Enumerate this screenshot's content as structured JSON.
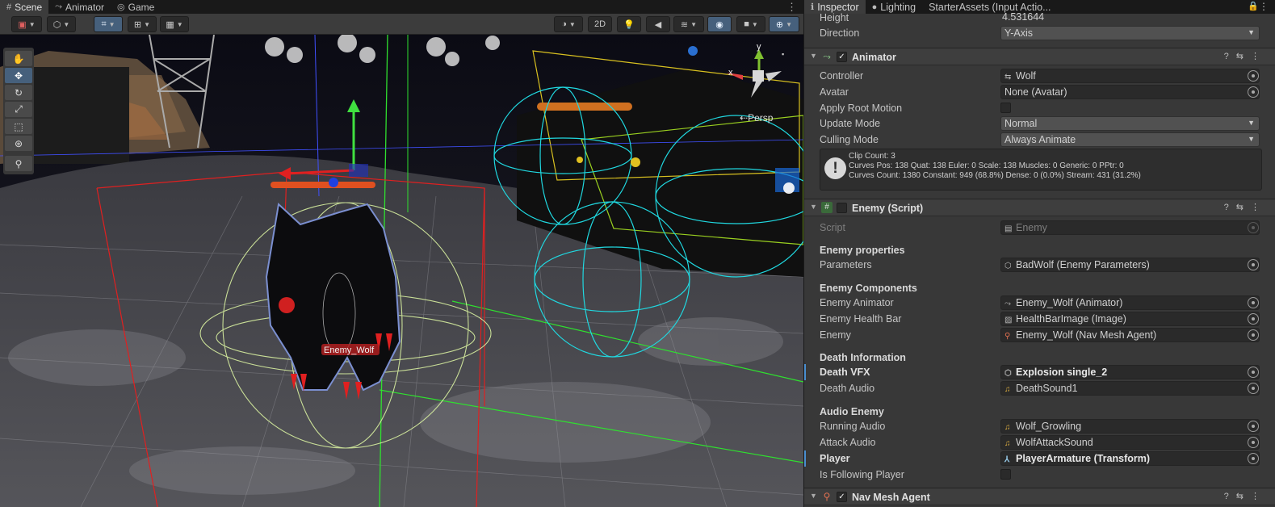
{
  "scene_tabs": [
    {
      "label": "Scene",
      "icon": "grid-icon"
    },
    {
      "label": "Animator",
      "icon": "animator-icon"
    },
    {
      "label": "Game",
      "icon": "gamepad-icon"
    }
  ],
  "scene_toolbar": {
    "twod_label": "2D"
  },
  "scene_view": {
    "persp_label": "Persp",
    "gizmo_axes": {
      "y": "y",
      "x": "x"
    },
    "enemy_label": "Enemy_Wolf"
  },
  "inspector_tabs": [
    {
      "label": "Inspector",
      "icon": "info-icon"
    },
    {
      "label": "Lighting",
      "icon": "bulb-icon"
    },
    {
      "label": "StarterAssets (Input Actio...",
      "icon": ""
    }
  ],
  "top_fields": [
    {
      "label": "Height",
      "value": "4.531644"
    },
    {
      "label": "Direction",
      "value": "Y-Axis"
    }
  ],
  "animator": {
    "title": "Animator",
    "enabled": true,
    "controller": {
      "label": "Controller",
      "value": "Wolf"
    },
    "avatar": {
      "label": "Avatar",
      "value": "None (Avatar)"
    },
    "apply_root_motion": {
      "label": "Apply Root Motion",
      "checked": false
    },
    "update_mode": {
      "label": "Update Mode",
      "value": "Normal"
    },
    "culling_mode": {
      "label": "Culling Mode",
      "value": "Always Animate"
    },
    "info": [
      "Clip Count: 3",
      "Curves Pos: 138 Quat: 138 Euler: 0 Scale: 138 Muscles: 0 Generic: 0 PPtr: 0",
      "Curves Count: 1380 Constant: 949 (68.8%) Dense: 0 (0.0%) Stream: 431 (31.2%)"
    ]
  },
  "enemy_script": {
    "title": "Enemy (Script)",
    "script": {
      "label": "Script",
      "value": "Enemy"
    },
    "section_properties": "Enemy properties",
    "parameters": {
      "label": "Parameters",
      "value": "BadWolf (Enemy Parameters)"
    },
    "section_components": "Enemy Components",
    "enemy_animator": {
      "label": "Enemy Animator",
      "value": "Enemy_Wolf (Animator)"
    },
    "enemy_health_bar": {
      "label": "Enemy Health Bar",
      "value": "HealthBarImage (Image)"
    },
    "enemy": {
      "label": "Enemy",
      "value": "Enemy_Wolf (Nav Mesh Agent)"
    },
    "section_death": "Death Information",
    "death_vfx": {
      "label": "Death VFX",
      "value": "Explosion single_2"
    },
    "death_audio": {
      "label": "Death Audio",
      "value": "DeathSound1"
    },
    "section_audio": "Audio Enemy",
    "running_audio": {
      "label": "Running Audio",
      "value": "Wolf_Growling"
    },
    "attack_audio": {
      "label": "Attack Audio",
      "value": "WolfAttackSound"
    },
    "player": {
      "label": "Player",
      "value": "PlayerArmature (Transform)"
    },
    "is_following_player": {
      "label": "Is Following Player",
      "checked": false
    }
  },
  "nav_mesh_agent": {
    "title": "Nav Mesh Agent",
    "enabled": true
  },
  "colors": {
    "accent_blue": "#46607c",
    "selection_marker": "#4a8fd1",
    "panel_bg": "#383838",
    "field_bg": "#2a2a2a"
  }
}
